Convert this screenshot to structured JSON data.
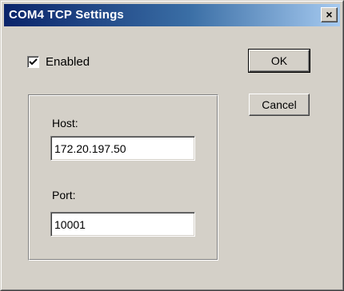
{
  "window": {
    "title": "COM4 TCP Settings",
    "close_glyph": "×"
  },
  "enabled": {
    "label": "Enabled",
    "checked": true
  },
  "connection": {
    "host_label": "Host:",
    "host_value": "172.20.197.50",
    "port_label": "Port:",
    "port_value": "10001"
  },
  "buttons": {
    "ok_label": "OK",
    "cancel_label": "Cancel"
  },
  "colors": {
    "titlebar_start": "#0a246a",
    "titlebar_end": "#a6caf0",
    "face": "#d4d0c8"
  },
  "icons": {
    "close": "close-icon",
    "check": "checkmark-icon"
  }
}
